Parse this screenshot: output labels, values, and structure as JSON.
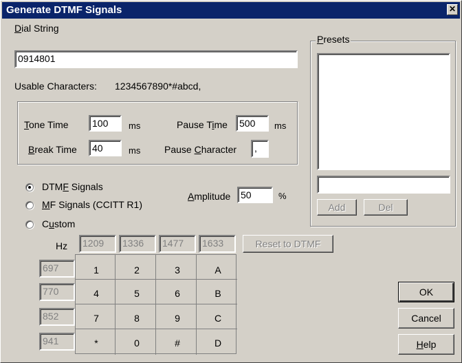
{
  "window": {
    "title": "Generate DTMF Signals",
    "close_glyph": "✕"
  },
  "dial": {
    "label_key": "D",
    "label_rest": "ial String",
    "value": "0914801"
  },
  "usable": {
    "label": "Usable Characters:",
    "value": "1234567890*#abcd,"
  },
  "timing": {
    "tone_key": "T",
    "tone_rest": "one Time",
    "tone_value": "100",
    "tone_unit": "ms",
    "break_key": "B",
    "break_rest": "reak Time",
    "break_value": "40",
    "break_unit": "ms",
    "pause_pre": "Pause T",
    "pause_key": "i",
    "pause_post": "me",
    "pause_value": "500",
    "pause_unit": "ms",
    "pchar_pre": "Pause ",
    "pchar_key": "C",
    "pchar_post": "haracter",
    "pchar_value": ","
  },
  "signals": {
    "dtmf_pre": "DTM",
    "dtmf_key": "F",
    "dtmf_post": " Signals",
    "mf_key": "M",
    "mf_post": "F Signals (CCITT R1)",
    "custom_pre": "C",
    "custom_key": "u",
    "custom_post": "stom",
    "selected": "dtmf"
  },
  "amplitude": {
    "key": "A",
    "rest": "mplitude",
    "value": "50",
    "unit": "%"
  },
  "presets": {
    "key": "P",
    "rest": "resets",
    "add_label": "Add",
    "del_label": "Del",
    "name_value": ""
  },
  "freq": {
    "hz_label": "Hz",
    "cols": [
      "1209",
      "1336",
      "1477",
      "1633"
    ],
    "rows": [
      "697",
      "770",
      "852",
      "941"
    ],
    "reset_label": "Reset to DTMF"
  },
  "keypad": [
    [
      "1",
      "2",
      "3",
      "A"
    ],
    [
      "4",
      "5",
      "6",
      "B"
    ],
    [
      "7",
      "8",
      "9",
      "C"
    ],
    [
      "*",
      "0",
      "#",
      "D"
    ]
  ],
  "buttons": {
    "ok": "OK",
    "cancel": "Cancel",
    "help_key": "H",
    "help_rest": "elp"
  }
}
